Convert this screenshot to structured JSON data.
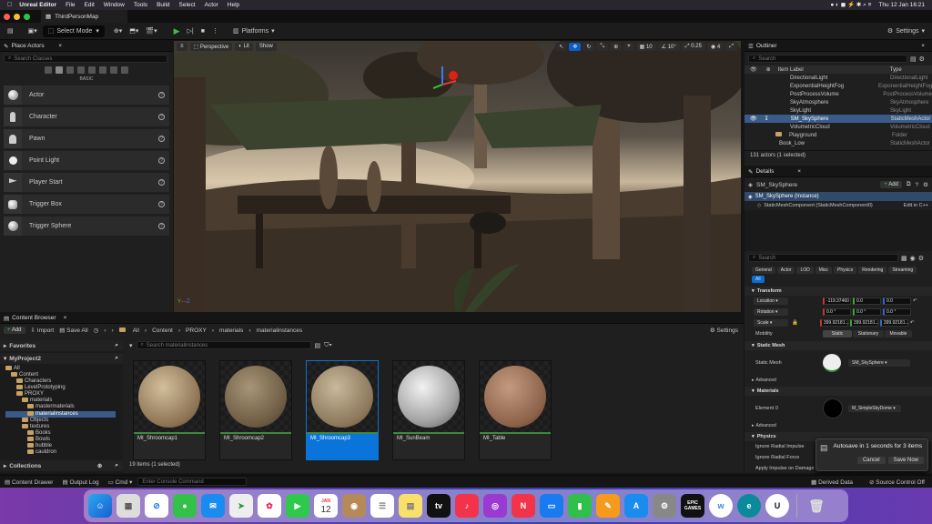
{
  "menubar": {
    "app": "Unreal Editor",
    "items": [
      "File",
      "Edit",
      "Window",
      "Tools",
      "Build",
      "Select",
      "Actor",
      "Help"
    ],
    "clock": "Thu 12 Jan  16:21"
  },
  "window": {
    "tab_title": "ThirdPersonMap"
  },
  "toolbar": {
    "select_mode": "Select Mode",
    "platforms": "Platforms",
    "settings": "Settings"
  },
  "place_actors": {
    "title": "Place Actors",
    "search_placeholder": "Search Classes",
    "category": "BASIC",
    "items": [
      "Actor",
      "Character",
      "Pawn",
      "Point Light",
      "Player Start",
      "Trigger Box",
      "Trigger Sphere"
    ]
  },
  "viewport": {
    "perspective": "Perspective",
    "lit": "Lit",
    "show": "Show",
    "grid_size": "10",
    "angle": "10°",
    "scale": "0.25",
    "camera_speed": "4"
  },
  "outliner": {
    "title": "Outliner",
    "search_placeholder": "Search",
    "col_label": "Item Label",
    "col_type": "Type",
    "rows": [
      {
        "label": "DirectionalLight",
        "type": "DirectionalLight"
      },
      {
        "label": "ExponentialHeightFog",
        "type": "ExponentialHeightFog"
      },
      {
        "label": "PostProcessVolume",
        "type": "PostProcessVolume"
      },
      {
        "label": "SkyAtmosphere",
        "type": "SkyAtmosphere"
      },
      {
        "label": "SkyLight",
        "type": "SkyLight"
      },
      {
        "label": "SM_SkySphere",
        "type": "StaticMeshActor"
      },
      {
        "label": "VolumetricCloud",
        "type": "VolumetricCloud"
      },
      {
        "label": "Playground",
        "type": "Folder"
      },
      {
        "label": "Book_Low",
        "type": "StaticMeshActor"
      }
    ],
    "status": "131 actors (1 selected)"
  },
  "details": {
    "title": "Details",
    "object_name": "SM_SkySphere",
    "add_label": "Add",
    "instance_label": "SM_SkySphere (Instance)",
    "component_label": "StaticMeshComponent (StaticMeshComponent0)",
    "edit_cpp": "Edit in C++",
    "search_placeholder": "Search",
    "filter_tabs": [
      "General",
      "Actor",
      "LOD",
      "Misc",
      "Physics",
      "Rendering",
      "Streaming",
      "All"
    ],
    "transform_header": "Transform",
    "location_label": "Location",
    "rotation_label": "Rotation",
    "scale_label": "Scale",
    "mobility_label": "Mobility",
    "location": [
      "-119.37460",
      "0.0",
      "0.0"
    ],
    "rotation": [
      "0.0 °",
      "0.0 °",
      "0.0 °"
    ],
    "scale": [
      "399.92181...",
      "399.92181...",
      "399.92181..."
    ],
    "mobility": [
      "Static",
      "Stationary",
      "Movable"
    ],
    "static_mesh_header": "Static Mesh",
    "static_mesh_label": "Static Mesh",
    "static_mesh_value": "SM_SkySphere",
    "advanced": "Advanced",
    "materials_header": "Materials",
    "element0_label": "Element 0",
    "element0_value": "M_SimpleSkyDome",
    "physics_header": "Physics",
    "physics_rows": [
      "Ignore Radial Impulse",
      "Ignore Radial Force",
      "Apply Impulse on Damage"
    ]
  },
  "autosave": {
    "message": "Autosave in 1 seconds for 3 items",
    "cancel": "Cancel",
    "save_now": "Save Now"
  },
  "content_browser": {
    "title": "Content Browser",
    "add": "Add",
    "import": "Import",
    "save_all": "Save All",
    "breadcrumb": [
      "All",
      "Content",
      "PROXY",
      "materials",
      "materialinstances"
    ],
    "settings": "Settings",
    "favorites": "Favorites",
    "project": "MyProject2",
    "search_placeholder": "Search materialinstances",
    "tree": [
      {
        "label": "All",
        "depth": 0
      },
      {
        "label": "Content",
        "depth": 1
      },
      {
        "label": "Characters",
        "depth": 2
      },
      {
        "label": "LevelPrototyping",
        "depth": 2
      },
      {
        "label": "PROXY",
        "depth": 2
      },
      {
        "label": "materials",
        "depth": 3
      },
      {
        "label": "mastermaterials",
        "depth": 4
      },
      {
        "label": "materialinstances",
        "depth": 4
      },
      {
        "label": "Objects",
        "depth": 3
      },
      {
        "label": "textures",
        "depth": 3
      },
      {
        "label": "Books",
        "depth": 4
      },
      {
        "label": "Bowls",
        "depth": 4
      },
      {
        "label": "bubble",
        "depth": 4
      },
      {
        "label": "cauldron",
        "depth": 4
      }
    ],
    "assets": [
      "MI_Shroomcap1",
      "MI_Shroomcap2",
      "MI_Shroomcap3",
      "MI_SunBeam",
      "MI_Table"
    ],
    "collections": "Collections",
    "status": "19 items (1 selected)"
  },
  "statusbar": {
    "content_drawer": "Content Drawer",
    "output_log": "Output Log",
    "cmd": "Cmd",
    "console_placeholder": "Enter Console Command",
    "derived_data": "Derived Data",
    "source_control": "Source Control Off"
  },
  "dock": {
    "calendar_month": "JAN",
    "calendar_day": "12",
    "epic_label": "EPIC GAMES"
  }
}
